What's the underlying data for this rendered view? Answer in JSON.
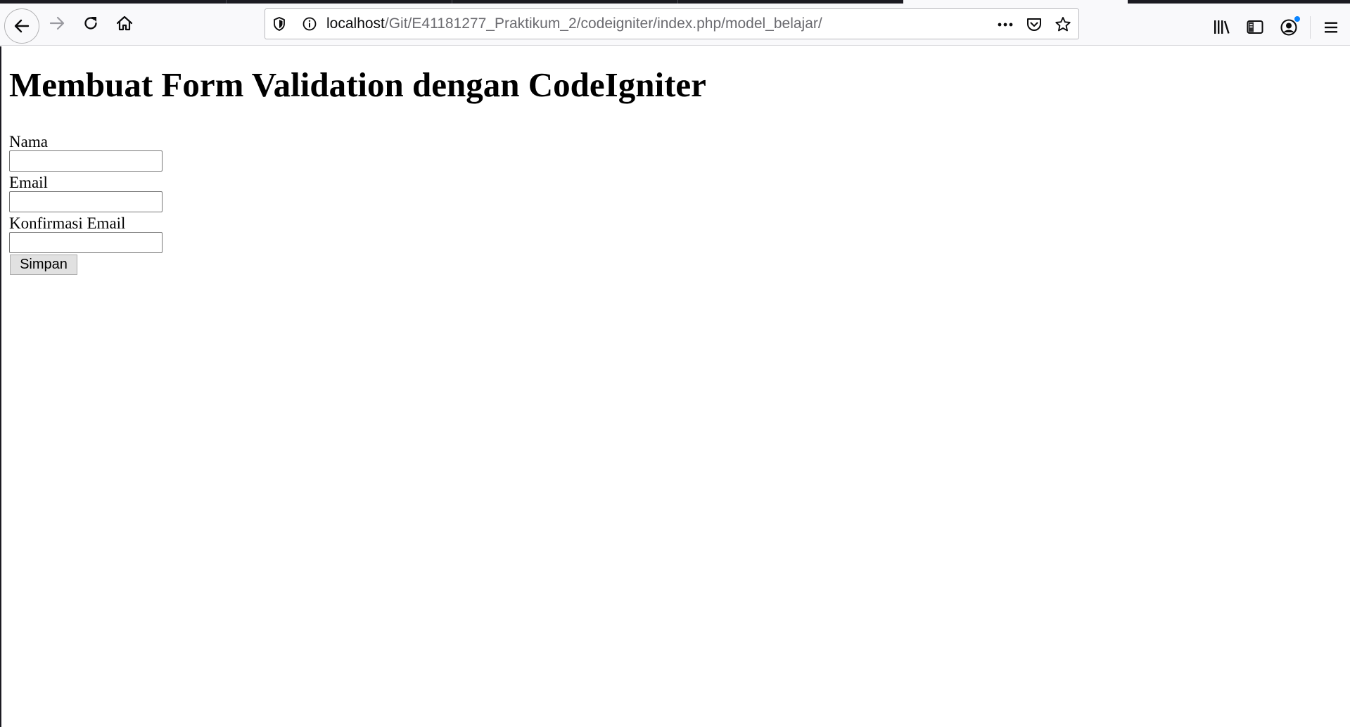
{
  "browser": {
    "url_host": "localhost",
    "url_path": "/Git/E41181277_Praktikum_2/codeigniter/index.php/model_belajar/",
    "icons": {
      "back": "back-arrow-icon",
      "forward": "forward-arrow-icon",
      "reload": "reload-icon",
      "home": "home-icon",
      "tracking": "shield-icon",
      "site_info": "info-icon",
      "page_actions": "more-dots-icon",
      "pocket": "pocket-icon",
      "bookmark": "star-icon",
      "library": "library-icon",
      "sidebar": "sidebar-icon",
      "account": "account-icon",
      "menu": "hamburger-menu-icon"
    }
  },
  "page": {
    "title": "Membuat Form Validation dengan CodeIgniter",
    "form": {
      "fields": [
        {
          "label": "Nama",
          "value": ""
        },
        {
          "label": "Email",
          "value": ""
        },
        {
          "label": "Konfirmasi Email",
          "value": ""
        }
      ],
      "submit_label": "Simpan"
    }
  },
  "colors": {
    "toolbar_bg": "#f9f9fb",
    "tabstrip_bg": "#1c1b22",
    "notification_dot": "#0a84ff"
  }
}
